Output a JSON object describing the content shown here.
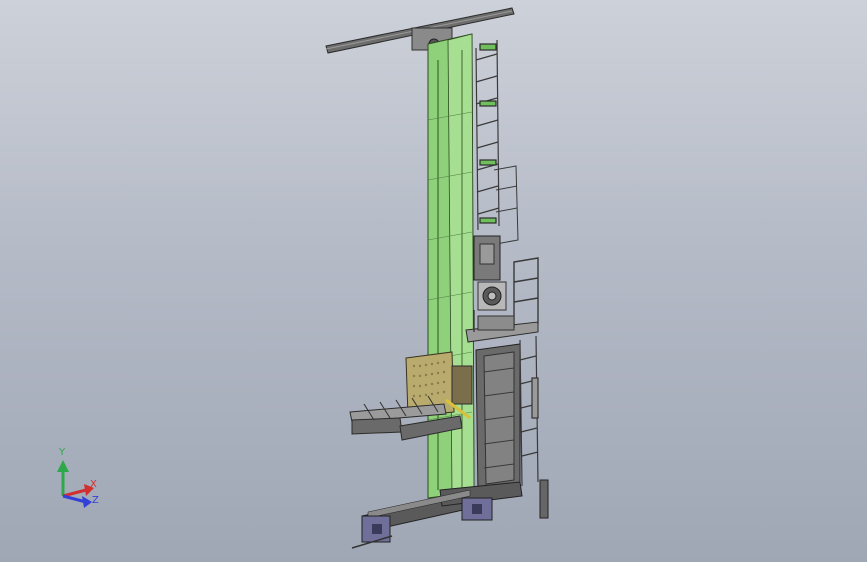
{
  "viewport": {
    "background_top": "#cdd1d9",
    "background_bottom": "#9fa7b5"
  },
  "model": {
    "mast_color": "#8fd17b",
    "structure_color": "#4a4a4a",
    "carriage_color": "#b9aa6e",
    "foot_color": "#6f6f9a"
  },
  "triad": {
    "x_label": "X",
    "y_label": "Y",
    "z_label": "Z",
    "x_color": "#d23030",
    "y_color": "#2ea84a",
    "z_color": "#3340d8"
  }
}
